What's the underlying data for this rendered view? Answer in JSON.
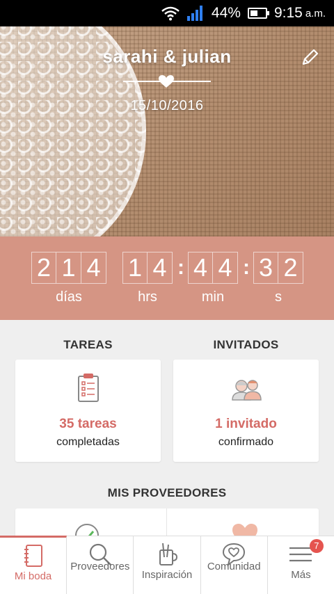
{
  "status_bar": {
    "percent": "44%",
    "time": "9:15",
    "ampm": "a.m.",
    "battery_level": 0.44
  },
  "hero": {
    "couple": "sarahi & julian",
    "date": "15/10/2016"
  },
  "countdown": {
    "days": [
      "2",
      "1",
      "4"
    ],
    "hours": [
      "1",
      "4"
    ],
    "minutes": [
      "4",
      "4"
    ],
    "seconds": [
      "3",
      "2"
    ],
    "labels": {
      "days": "días",
      "hours": "hrs",
      "minutes": "min",
      "seconds": "s"
    }
  },
  "tasks": {
    "title": "TAREAS",
    "count": "35 tareas",
    "sub": "completadas"
  },
  "guests": {
    "title": "INVITADOS",
    "count": "1 invitado",
    "sub": "confirmado"
  },
  "providers": {
    "title": "MIS PROVEEDORES"
  },
  "nav": {
    "items": [
      {
        "label": "Mi boda",
        "icon": "notebook-icon"
      },
      {
        "label": "Proveedores",
        "icon": "search-icon"
      },
      {
        "label": "Inspiración",
        "icon": "inspiration-icon"
      },
      {
        "label": "Comunidad",
        "icon": "community-icon"
      },
      {
        "label": "Más",
        "icon": "menu-icon"
      }
    ],
    "badge": "7"
  },
  "colors": {
    "accent": "#d46b66",
    "countdown_bg": "#d59584"
  }
}
